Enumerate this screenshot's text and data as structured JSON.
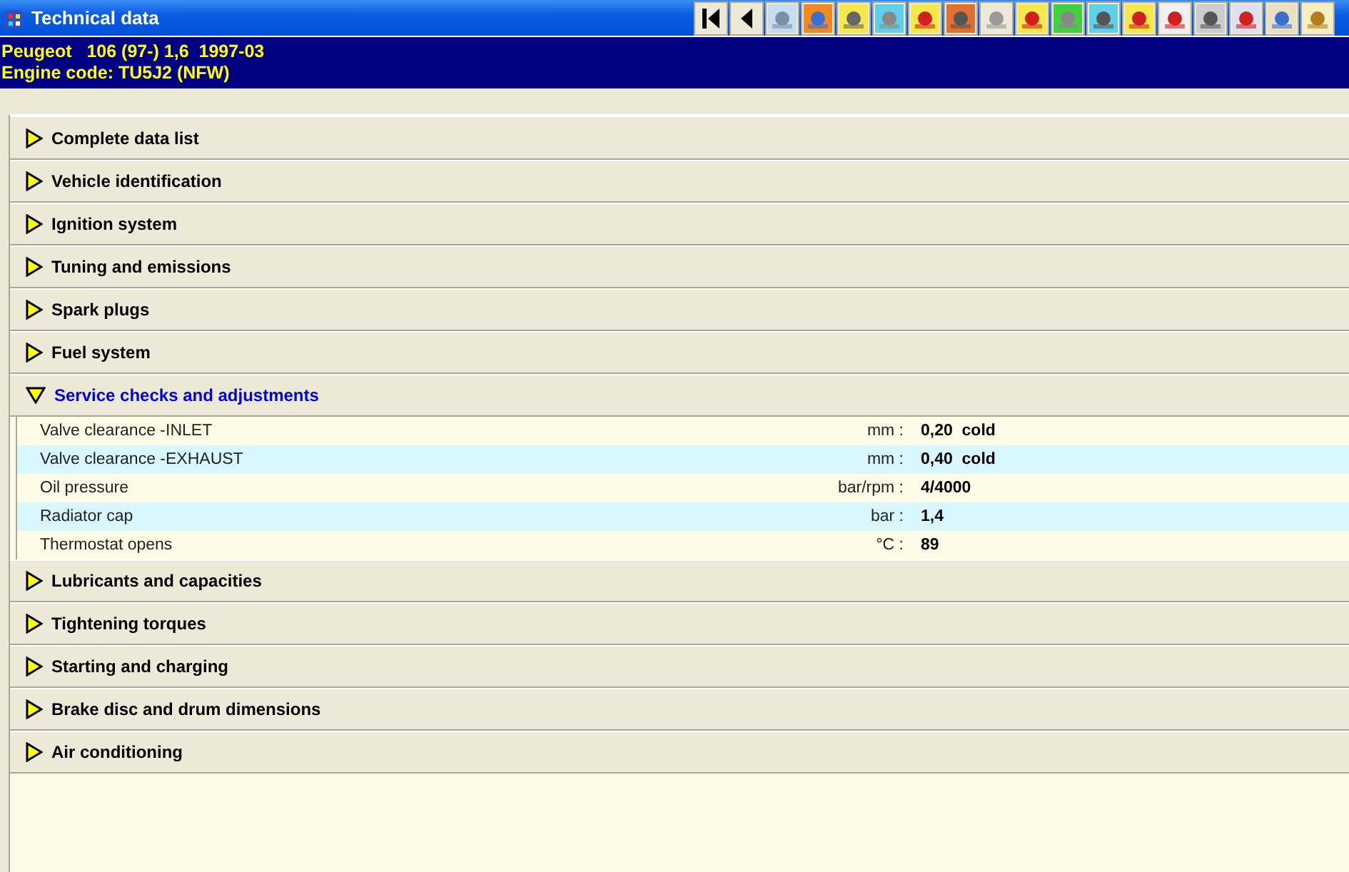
{
  "window": {
    "title": "Technical data"
  },
  "vehicle": {
    "model": "Peugeot   106 (97-) 1,6  1997-03",
    "engine": "Engine code: TU5J2 (NFW)"
  },
  "sections": [
    {
      "label": "Complete data list",
      "expanded": false
    },
    {
      "label": "Vehicle identification",
      "expanded": false
    },
    {
      "label": "Ignition system",
      "expanded": false
    },
    {
      "label": "Tuning and emissions",
      "expanded": false
    },
    {
      "label": "Spark plugs",
      "expanded": false
    },
    {
      "label": "Fuel system",
      "expanded": false
    },
    {
      "label": "Service checks and adjustments",
      "expanded": true,
      "rows": [
        {
          "label": "Valve clearance  -INLET",
          "unit": "mm :",
          "value": "0,20  cold"
        },
        {
          "label": "Valve clearance  -EXHAUST",
          "unit": "mm :",
          "value": "0,40  cold"
        },
        {
          "label": "Oil pressure",
          "unit": "bar/rpm :",
          "value": "4/4000"
        },
        {
          "label": "Radiator cap",
          "unit": "bar :",
          "value": "1,4"
        },
        {
          "label": "Thermostat opens",
          "unit": "°C :",
          "value": "89"
        }
      ]
    },
    {
      "label": "Lubricants and capacities",
      "expanded": false
    },
    {
      "label": "Tightening torques",
      "expanded": false
    },
    {
      "label": "Starting and charging",
      "expanded": false
    },
    {
      "label": "Brake disc and drum dimensions",
      "expanded": false
    },
    {
      "label": "Air conditioning",
      "expanded": false
    }
  ]
}
